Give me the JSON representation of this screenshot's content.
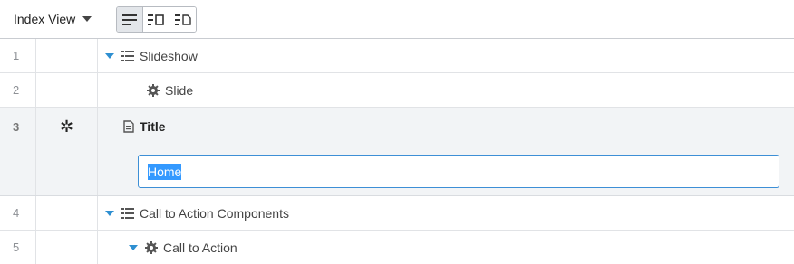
{
  "toolbar": {
    "view_label": "Index View",
    "view_buttons": [
      {
        "icon": "list-view-icon",
        "active": true
      },
      {
        "icon": "list-with-box-icon",
        "active": false
      },
      {
        "icon": "list-with-page-icon",
        "active": false
      }
    ]
  },
  "rows": [
    {
      "num": "1",
      "label": "Slideshow",
      "icon": "list-icon",
      "expanded": true
    },
    {
      "num": "2",
      "label": "Slide",
      "icon": "gear-icon"
    },
    {
      "num": "3",
      "label": "Title",
      "icon": "document-icon",
      "marker": "✲",
      "selected": true
    },
    {
      "num": "",
      "edit_value": "Home"
    },
    {
      "num": "4",
      "label": "Call to Action Components",
      "icon": "list-icon",
      "expanded": true
    },
    {
      "num": "5",
      "label": "Call to Action",
      "icon": "gear-icon",
      "expanded": true
    }
  ],
  "colors": {
    "accent": "#2e8fd1",
    "selection": "#3399ff",
    "border": "#c9ccd1"
  }
}
